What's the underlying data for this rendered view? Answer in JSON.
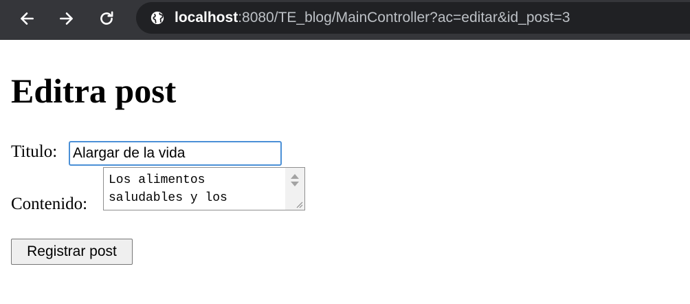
{
  "browser": {
    "url_host": "localhost",
    "url_path": ":8080/TE_blog/MainController?ac=editar&id_post=3",
    "icons": {
      "back": "arrow-left-icon",
      "forward": "arrow-right-icon",
      "reload": "reload-icon",
      "site": "globe-icon"
    },
    "colors": {
      "toolbar_bg": "#35363a",
      "omnibox_bg": "#202124"
    }
  },
  "page": {
    "title": "Editra post",
    "form": {
      "titulo_label": "Titulo:",
      "titulo_value": "Alargar de la vida",
      "contenido_label": "Contenido:",
      "contenido_value": "Los alimentos saludables y los",
      "submit_label": "Registrar post"
    },
    "colors": {
      "input_focus_border": "#4a8fd6"
    }
  }
}
